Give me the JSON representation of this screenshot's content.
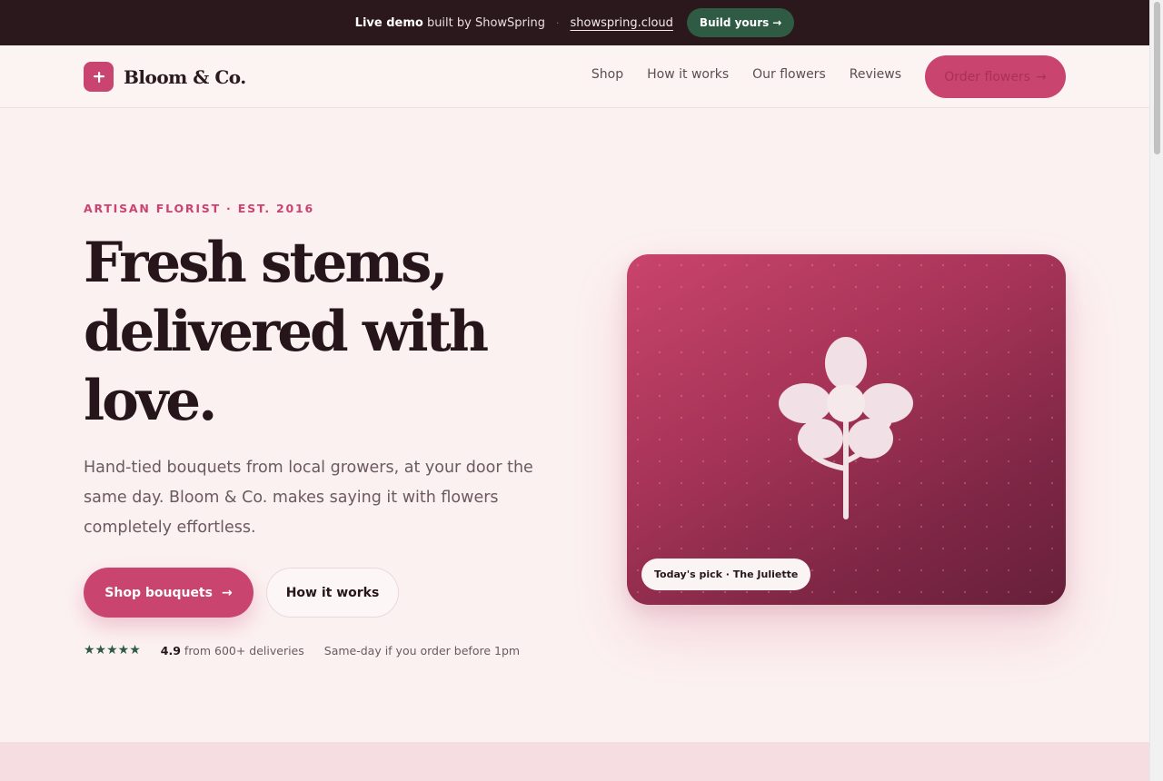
{
  "demo_bar": {
    "lead_strong": "Live demo",
    "lead_rest": " built by ShowSpring",
    "separator": "·",
    "link": "showspring.cloud",
    "button": "Build yours",
    "button_arrow": "→"
  },
  "nav": {
    "brand_icon_glyph": "+",
    "brand": "Bloom & Co.",
    "links": [
      "Shop",
      "How it works",
      "Our flowers",
      "Reviews"
    ],
    "cta": "Order flowers",
    "cta_arrow": "→"
  },
  "hero": {
    "eyebrow": "ARTISAN FLORIST · EST. 2016",
    "headline": [
      "Fresh stems,",
      "delivered with",
      "love."
    ],
    "lede": "Hand-tied bouquets from local growers, at your door the same day. Bloom & Co. makes saying it with flowers completely effortless.",
    "primary_cta": "Shop bouquets",
    "primary_cta_arrow": "→",
    "secondary_cta": "How it works",
    "stars": "★★★★★",
    "rating_value": "4.9",
    "rating_text": "from 600+ deliveries",
    "same_day": "Same-day if you order before 1pm"
  },
  "card": {
    "pill": "Today's pick · The Juliette",
    "icon": "flower-illustration"
  },
  "colors": {
    "accent": "#c9446f",
    "dark": "#2b181d",
    "green": "#2f5b45",
    "background": "#fcf1f1"
  }
}
